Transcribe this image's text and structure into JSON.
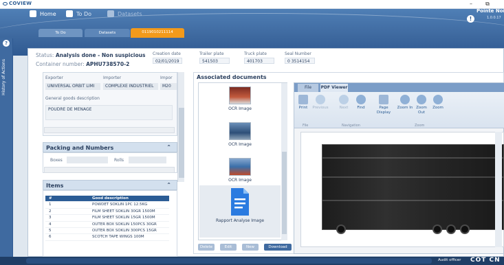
{
  "window": {
    "app_name": "COVIEW",
    "min_glyph": "–",
    "max_glyph": "⧉"
  },
  "nav": {
    "home": "Home",
    "todo": "To Do",
    "datasets": "Datasets"
  },
  "profile": {
    "city": "Pointe Noire",
    "version": "1.0.0.17"
  },
  "tabs": [
    {
      "label": "To Do"
    },
    {
      "label": "Datasets"
    },
    {
      "label": "0119010211114"
    }
  ],
  "sidebar": {
    "label": "History of Actions"
  },
  "header": {
    "status_label": "Status:",
    "status_value": "Analysis done - Non suspicious",
    "container_label": "Container number:",
    "container_value": "APHU738570-2",
    "creation_date_label": "Creation date",
    "creation_date_value": "02/01/2019",
    "trailer_label": "Trailer plate",
    "trailer_value": "541503",
    "truck_label": "Truck plate",
    "truck_value": "401703",
    "seal_label": "Seal Number",
    "seal_value": "0 3514154"
  },
  "shipment": {
    "exporter_label": "Exporter",
    "exporter_value": "UNIVERSAL ORBIT LIMI",
    "importer_label": "Importer",
    "importer_value": "COMPLEXE INDUSTRIEL",
    "import_label": "Impor",
    "import_value": "M20",
    "goods_label": "General goods description",
    "goods_value": "POUDRE DE MENAGE"
  },
  "packing": {
    "title": "Packing and Numbers",
    "boxes_label": "Boxes",
    "rolls_label": "Rolls"
  },
  "items": {
    "title": "Items",
    "columns": [
      "#",
      "Good description"
    ],
    "rows": [
      {
        "n": "1",
        "desc": "POWDET SOKLIN 1PC 12.5KG"
      },
      {
        "n": "2",
        "desc": "FILM SHEET SOKLIN 30GR 1500M"
      },
      {
        "n": "3",
        "desc": "FILM SHEET SOKLIN 15GR 1500M"
      },
      {
        "n": "4",
        "desc": "OUTER BOX SOKLIN 150PCS 30GR"
      },
      {
        "n": "5",
        "desc": "OUTER BOX SOKLIN 300PCS 15GR"
      },
      {
        "n": "6",
        "desc": "SCOTCH TAPE WINGS 100M"
      }
    ]
  },
  "documents": {
    "title": "Associated documents",
    "list": [
      {
        "label": "OCR Image"
      },
      {
        "label": "OCR Image"
      },
      {
        "label": "OCR Image"
      },
      {
        "label": "Rapport Analyse Image"
      }
    ],
    "buttons": {
      "delete": "Delete",
      "edit": "Edit",
      "new": "New",
      "download": "Download"
    }
  },
  "viewer": {
    "file_tab": "File",
    "pdf_tab": "PDF Viewer",
    "buttons": {
      "print": "Print",
      "previous": "Previous",
      "next": "Next",
      "find": "Find",
      "page_display": "Page Display",
      "zoom_in": "Zoom In",
      "zoom_out": "Zoom Out",
      "zoom": "Zoom"
    },
    "groups": {
      "file": "File",
      "navigation": "Navigation",
      "zoom": "Zoom"
    }
  },
  "footer": {
    "audit": "Audit officer",
    "brand_left": "COT",
    "brand_right": "CN"
  },
  "colors": {
    "primary": "#3f6aa0",
    "accent_tab": "#f39a1b",
    "table_header": "#2b5c95"
  }
}
